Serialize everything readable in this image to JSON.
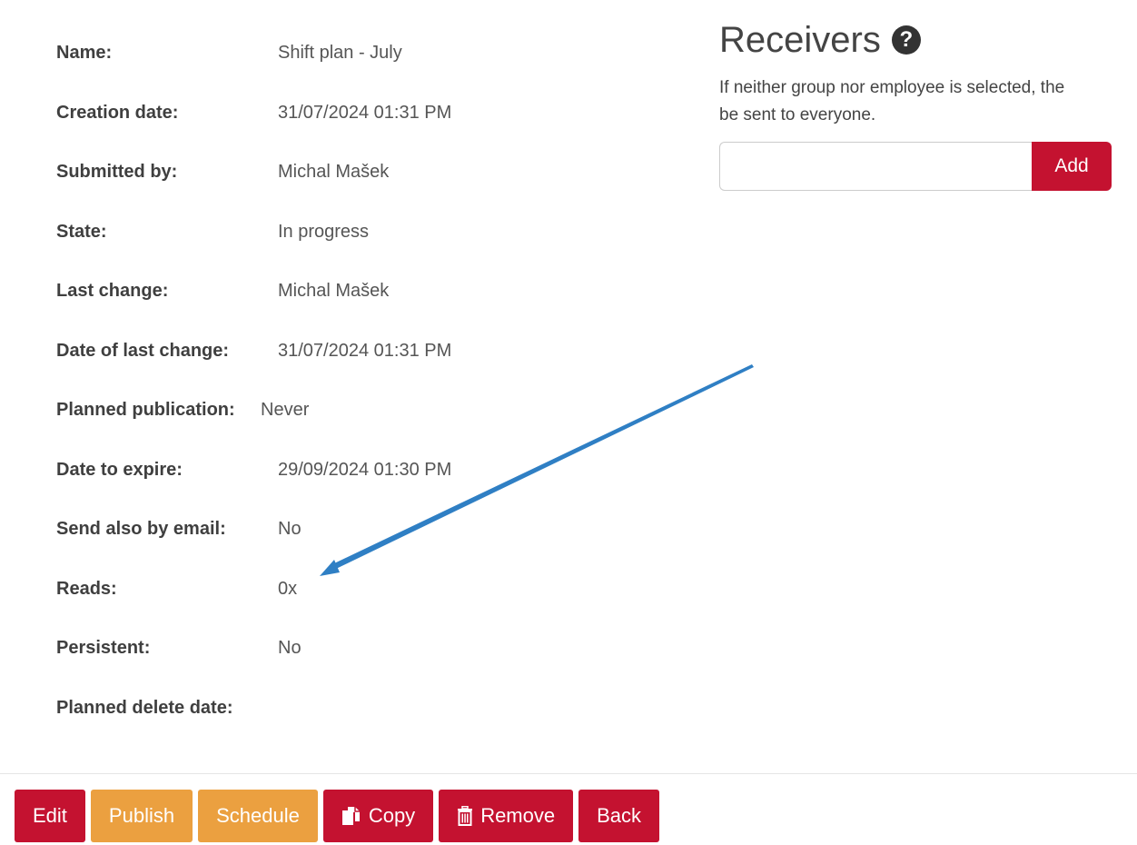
{
  "details": {
    "rows": [
      {
        "label": "Name:",
        "value": "Shift plan - July"
      },
      {
        "label": "Creation date:",
        "value": "31/07/2024 01:31 PM"
      },
      {
        "label": "Submitted by:",
        "value": "Michal Mašek"
      },
      {
        "label": "State:",
        "value": "In progress"
      },
      {
        "label": "Last change:",
        "value": "Michal Mašek"
      },
      {
        "label": "Date of last change:",
        "value": "31/07/2024 01:31 PM"
      },
      {
        "label": "Planned publication:",
        "value": "Never"
      },
      {
        "label": "Date to expire:",
        "value": "29/09/2024 01:30 PM"
      },
      {
        "label": "Send also by email:",
        "value": "No"
      },
      {
        "label": "Reads:",
        "value": "0x"
      },
      {
        "label": "Persistent:",
        "value": "No"
      },
      {
        "label": "Planned delete date:",
        "value": ""
      }
    ]
  },
  "receivers": {
    "title": "Receivers",
    "help_icon": "?",
    "hint": "If neither group nor employee is selected, the",
    "hint_line2": "be sent to everyone.",
    "input_value": "",
    "add_label": "Add"
  },
  "toolbar": {
    "edit_label": "Edit",
    "publish_label": "Publish",
    "schedule_label": "Schedule",
    "copy_label": "Copy",
    "remove_label": "Remove",
    "back_label": "Back"
  },
  "colors": {
    "primary_red": "#c41230",
    "orange": "#eba040",
    "arrow_blue": "#2f7fc4"
  }
}
